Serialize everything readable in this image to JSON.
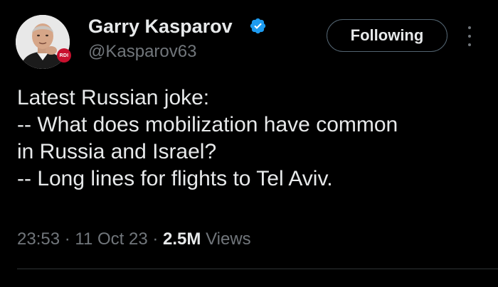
{
  "author": {
    "display_name": "Garry Kasparov",
    "handle": "@Kasparov63",
    "verified": true,
    "avatar_badge": "RDI"
  },
  "actions": {
    "follow_label": "Following"
  },
  "tweet": {
    "lines": [
      "Latest Russian joke:",
      "-- What does mobilization have common",
      "in Russia and Israel?",
      "-- Long lines for flights to Tel Aviv."
    ]
  },
  "meta": {
    "time": "23:53",
    "date": "11 Oct 23",
    "separator": "·",
    "views_count": "2.5M",
    "views_label": "Views"
  },
  "colors": {
    "background": "#000000",
    "text_primary": "#e7e9ea",
    "text_secondary": "#71767b",
    "verified_badge": "#1d9bf0",
    "button_border": "#536471"
  },
  "icons": {
    "verified": "verified-badge-icon",
    "more": "more-dots-vertical-icon"
  }
}
